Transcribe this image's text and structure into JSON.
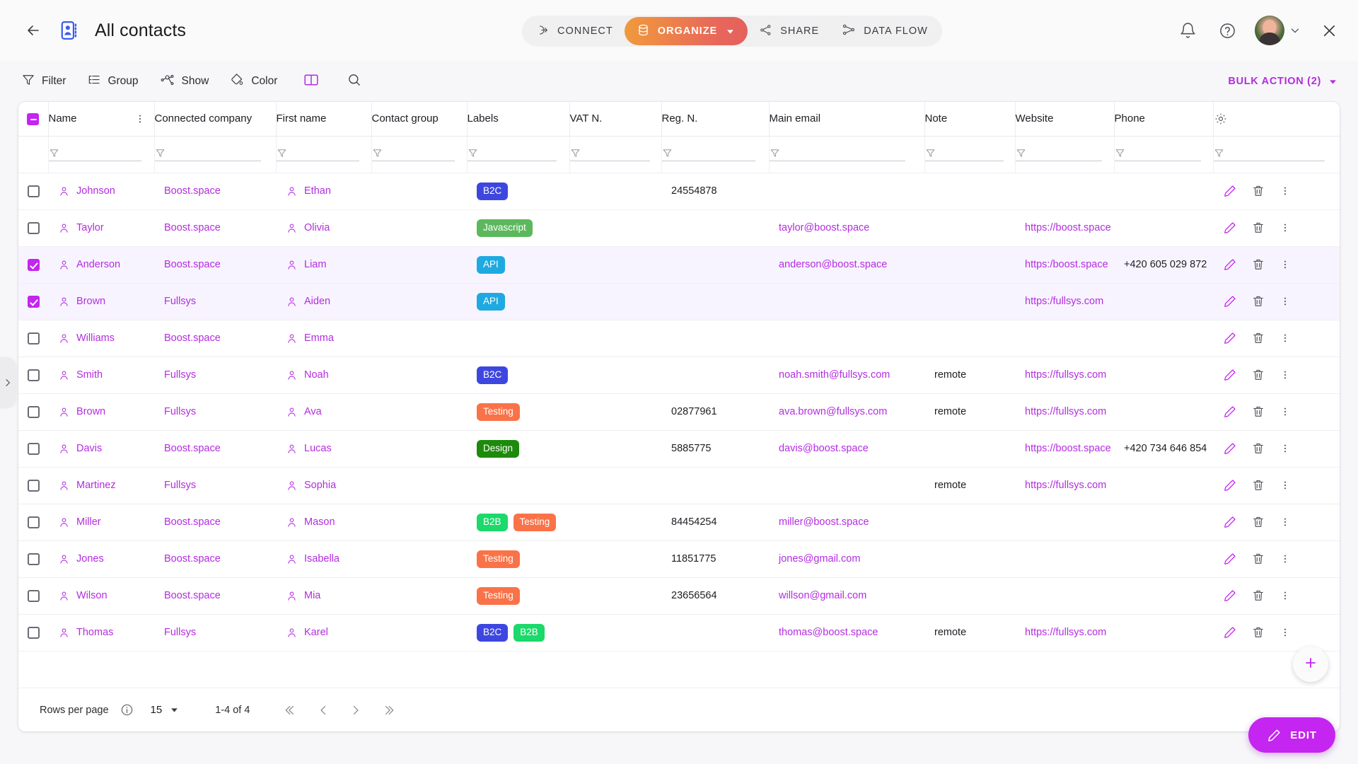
{
  "header": {
    "back_icon": "arrow-left-icon",
    "app_icon": "contact-book-icon",
    "title": "All contacts",
    "nav": [
      {
        "label": "CONNECT",
        "icon": "connect-icon",
        "active": false
      },
      {
        "label": "ORGANIZE",
        "icon": "database-icon",
        "active": true,
        "has_caret": true
      },
      {
        "label": "SHARE",
        "icon": "share-icon",
        "active": false
      },
      {
        "label": "DATA FLOW",
        "icon": "data-flow-icon",
        "active": false
      }
    ],
    "accent_gradient_from": "#ef9a3d",
    "accent_gradient_to": "#e4605e",
    "right_icons": [
      "bell-icon",
      "help-icon",
      "avatar",
      "chevron-down-icon",
      "close-icon"
    ]
  },
  "toolbar": {
    "items": [
      {
        "label": "Filter",
        "icon": "filter-icon"
      },
      {
        "label": "Group",
        "icon": "group-icon"
      },
      {
        "label": "Show",
        "icon": "show-icon"
      },
      {
        "label": "Color",
        "icon": "color-icon"
      }
    ],
    "layout_icon": "columns-layout-icon",
    "search_icon": "search-icon",
    "bulk_action_label": "BULK ACTION (2)",
    "bulk_action_color": "#b42ce0"
  },
  "table": {
    "columns": [
      "Name",
      "Connected company",
      "First name",
      "Contact group",
      "Labels",
      "VAT N.",
      "Reg. N.",
      "Main email",
      "Note",
      "Website",
      "Phone"
    ],
    "settings_icon": "gear-icon",
    "header_checkbox_state": "indeterminate",
    "kebab_icon": "more-vertical-icon",
    "filter_row_icon": "filter-icon",
    "rows": [
      {
        "selected": false,
        "name": "Johnson",
        "company": "Boost.space",
        "first_name": "Ethan",
        "contact_group": "",
        "labels": [
          {
            "text": "B2C",
            "color": "#3d47e0"
          }
        ],
        "vat": "",
        "reg": "24554878",
        "email": "",
        "note": "",
        "website": "",
        "phone": ""
      },
      {
        "selected": false,
        "name": "Taylor",
        "company": "Boost.space",
        "first_name": "Olivia",
        "contact_group": "",
        "labels": [
          {
            "text": "Javascript",
            "color": "#5cb85c"
          }
        ],
        "vat": "",
        "reg": "",
        "email": "taylor@boost.space",
        "note": "",
        "website": "https://boost.space",
        "phone": ""
      },
      {
        "selected": true,
        "name": "Anderson",
        "company": "Boost.space",
        "first_name": "Liam",
        "contact_group": "",
        "labels": [
          {
            "text": "API",
            "color": "#1eaae0"
          }
        ],
        "vat": "",
        "reg": "",
        "email": "anderson@boost.space",
        "note": "",
        "website": "https:/boost.space",
        "phone": "+420 605 029 872"
      },
      {
        "selected": true,
        "name": "Brown",
        "company": "Fullsys",
        "first_name": "Aiden",
        "contact_group": "",
        "labels": [
          {
            "text": "API",
            "color": "#1eaae0"
          }
        ],
        "vat": "",
        "reg": "",
        "email": "",
        "note": "",
        "website": "https:/fullsys.com",
        "phone": ""
      },
      {
        "selected": false,
        "name": "Williams",
        "company": "Boost.space",
        "first_name": "Emma",
        "contact_group": "",
        "labels": [],
        "vat": "",
        "reg": "",
        "email": "",
        "note": "",
        "website": "",
        "phone": ""
      },
      {
        "selected": false,
        "name": "Smith",
        "company": "Fullsys",
        "first_name": "Noah",
        "contact_group": "",
        "labels": [
          {
            "text": "B2C",
            "color": "#3d47e0"
          }
        ],
        "vat": "",
        "reg": "",
        "email": "noah.smith@fullsys.com",
        "note": "remote",
        "website": "https://fullsys.com",
        "phone": ""
      },
      {
        "selected": false,
        "name": "Brown",
        "company": "Fullsys",
        "first_name": "Ava",
        "contact_group": "",
        "labels": [
          {
            "text": "Testing",
            "color": "#fa7248"
          }
        ],
        "vat": "",
        "reg": "02877961",
        "email": "ava.brown@fullsys.com",
        "note": "remote",
        "website": "https://fullsys.com",
        "phone": ""
      },
      {
        "selected": false,
        "name": "Davis",
        "company": "Boost.space",
        "first_name": "Lucas",
        "contact_group": "",
        "labels": [
          {
            "text": "Design",
            "color": "#1d8a0c"
          }
        ],
        "vat": "",
        "reg": "5885775",
        "email": "davis@boost.space",
        "note": "",
        "website": "https://boost.space",
        "phone": "+420 734 646 854"
      },
      {
        "selected": false,
        "name": "Martinez",
        "company": "Fullsys",
        "first_name": "Sophia",
        "contact_group": "",
        "labels": [],
        "vat": "",
        "reg": "",
        "email": "",
        "note": "remote",
        "website": "https://fullsys.com",
        "phone": ""
      },
      {
        "selected": false,
        "name": "Miller",
        "company": "Boost.space",
        "first_name": "Mason",
        "contact_group": "",
        "labels": [
          {
            "text": "B2B",
            "color": "#1bd96a"
          },
          {
            "text": "Testing",
            "color": "#fa7248"
          }
        ],
        "vat": "",
        "reg": "84454254",
        "email": "miller@boost.space",
        "note": "",
        "website": "",
        "phone": ""
      },
      {
        "selected": false,
        "name": "Jones",
        "company": "Boost.space",
        "first_name": "Isabella",
        "contact_group": "",
        "labels": [
          {
            "text": "Testing",
            "color": "#fa7248"
          }
        ],
        "vat": "",
        "reg": "11851775",
        "email": "jones@gmail.com",
        "note": "",
        "website": "",
        "phone": ""
      },
      {
        "selected": false,
        "name": "Wilson",
        "company": "Boost.space",
        "first_name": "Mia",
        "contact_group": "",
        "labels": [
          {
            "text": "Testing",
            "color": "#fa7248"
          }
        ],
        "vat": "",
        "reg": "23656564",
        "email": "willson@gmail.com",
        "note": "",
        "website": "",
        "phone": ""
      },
      {
        "selected": false,
        "name": "Thomas",
        "company": "Fullsys",
        "first_name": "Karel",
        "contact_group": "",
        "labels": [
          {
            "text": "B2C",
            "color": "#3d47e0"
          },
          {
            "text": "B2B",
            "color": "#1bd96a"
          }
        ],
        "vat": "",
        "reg": "",
        "email": "thomas@boost.space",
        "note": "remote",
        "website": "https://fullsys.com",
        "phone": ""
      }
    ],
    "row_actions": {
      "edit_icon": "pencil-icon",
      "delete_icon": "trash-icon",
      "menu_icon": "more-vertical-icon"
    }
  },
  "footer": {
    "rows_per_page_label": "Rows per page",
    "info_icon": "info-icon",
    "rows_per_page_value": "15",
    "range_text": "1-4 of 4",
    "pager": [
      "first-page-icon",
      "prev-page-icon",
      "next-page-icon",
      "last-page-icon"
    ]
  },
  "fabs": {
    "add_label": "+",
    "add_icon": "plus-icon",
    "edit_label": "EDIT",
    "edit_icon": "pencil-icon",
    "edit_color": "#c425f0"
  },
  "edge_tab_icon": "chevron-right-icon"
}
